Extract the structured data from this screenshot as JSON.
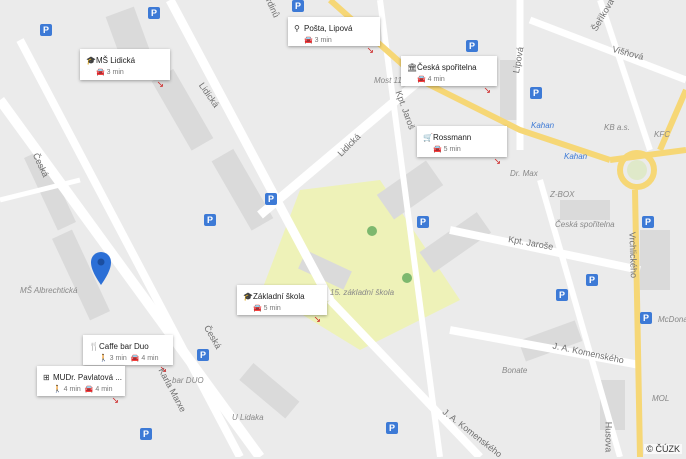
{
  "streets": [
    {
      "name": "Lidická"
    },
    {
      "name": "Lidická"
    },
    {
      "name": "Česká"
    },
    {
      "name": "Česká"
    },
    {
      "name": "Kpt. Jaroše"
    },
    {
      "name": "Kpt. Jaroš"
    },
    {
      "name": "Lipová"
    },
    {
      "name": "Višňová"
    },
    {
      "name": "Šeříkova"
    },
    {
      "name": "J. A. Komenského"
    },
    {
      "name": "J. A. Komenského"
    },
    {
      "name": "Vrchlického"
    },
    {
      "name": "Karla Marxe"
    },
    {
      "name": "Hrdinů"
    },
    {
      "name": "Husova"
    }
  ],
  "places": [
    {
      "name": "MŠ Albrechtická"
    },
    {
      "name": "15. základní škola"
    },
    {
      "name": "Most 11"
    },
    {
      "name": "KB a.s."
    },
    {
      "name": "KFC"
    },
    {
      "name": "Kahan"
    },
    {
      "name": "Kahan"
    },
    {
      "name": "Dr. Max"
    },
    {
      "name": "Z-BOX"
    },
    {
      "name": "Česká spořitelna"
    },
    {
      "name": "McDonald's"
    },
    {
      "name": "MOL"
    },
    {
      "name": "Bonate"
    },
    {
      "name": "bar DUO"
    },
    {
      "name": "U Lidaka"
    }
  ],
  "cards": [
    {
      "title": "MŠ Lidická",
      "icon": "school-icon",
      "walk": "",
      "drive": "3 min"
    },
    {
      "title": "Pošta, Lipová",
      "icon": "post-icon",
      "walk": "",
      "drive": "3 min"
    },
    {
      "title": "Česká spořitelna",
      "icon": "bank-icon",
      "walk": "",
      "drive": "4 min"
    },
    {
      "title": "Rossmann",
      "icon": "shop-icon",
      "walk": "",
      "drive": "5 min"
    },
    {
      "title": "Základní škola",
      "icon": "school-icon",
      "walk": "",
      "drive": "5 min"
    },
    {
      "title": "Caffe bar Duo",
      "icon": "restaurant-icon",
      "walk": "3 min",
      "drive": "4 min"
    },
    {
      "title": "MUDr. Pavlatová ...",
      "icon": "doctor-icon",
      "walk": "4 min",
      "drive": "4 min"
    }
  ],
  "parking_label": "P",
  "copyright": "© ČÚZK",
  "colors": {
    "background": "#ebebeb",
    "road": "#ffffff",
    "main_road": "#f7d774",
    "park": "#eef1b0",
    "pin": "#2b6fd6",
    "parking": "#3d7ad6"
  }
}
